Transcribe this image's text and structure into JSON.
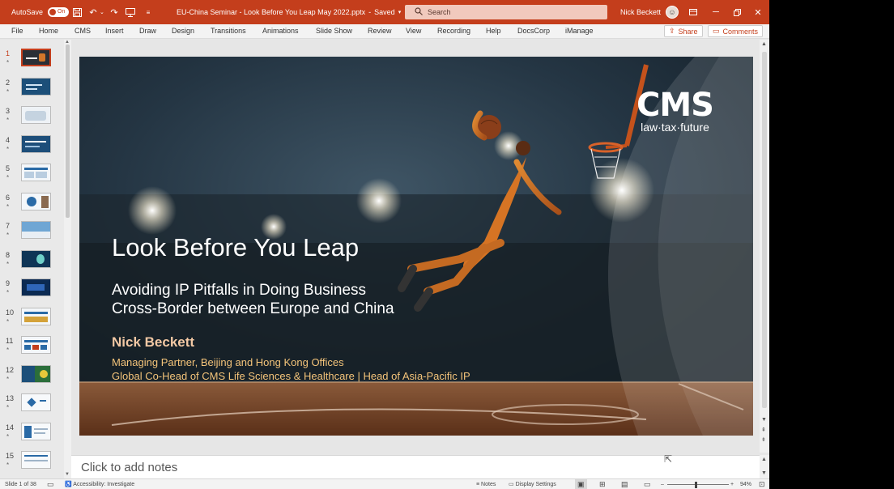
{
  "titlebar": {
    "autosave_label": "AutoSave",
    "autosave_state": "On",
    "document_title": "EU-China Seminar - Look Before You Leap May 2022.pptx",
    "saved_status": "Saved",
    "search_placeholder": "Search",
    "user_name": "Nick Beckett",
    "icons": [
      "save-icon",
      "undo-icon",
      "redo-icon",
      "present-icon",
      "customize-qat-icon"
    ]
  },
  "ribbon": {
    "tabs": [
      "File",
      "Home",
      "CMS",
      "Insert",
      "Draw",
      "Design",
      "Transitions",
      "Animations",
      "Slide Show",
      "Review",
      "View",
      "Recording",
      "Help",
      "DocsCorp",
      "iManage"
    ],
    "share_label": "Share",
    "comments_label": "Comments"
  },
  "thumbnails": {
    "numbers": [
      "1",
      "2",
      "3",
      "4",
      "5",
      "6",
      "7",
      "8",
      "9",
      "10",
      "11",
      "12",
      "13",
      "14",
      "15"
    ],
    "active_index": 0,
    "star": "*"
  },
  "slide": {
    "title": "Look Before You Leap",
    "subtitle_line1": "Avoiding IP Pitfalls in Doing Business",
    "subtitle_line2": "Cross-Border between Europe and China",
    "presenter_name": "Nick Beckett",
    "role_line1": "Managing Partner, Beijing and Hong Kong Offices",
    "role_line2": "Global Co-Head of CMS Life Sciences & Healthcare | Head of Asia-Pacific IP",
    "logo_text": "CMS",
    "logo_tagline": "law·tax·future"
  },
  "notes": {
    "placeholder": "Click to add notes"
  },
  "statusbar": {
    "slide_counter": "Slide 1 of 38",
    "accessibility": "Accessibility: Investigate",
    "notes_label": "Notes",
    "display_settings_label": "Display Settings",
    "zoom_minus": "–",
    "zoom_plus": "+",
    "zoom_level": "94%"
  },
  "colors": {
    "accent": "#c43e1c",
    "presenter_name": "#f2c8a4",
    "role_text": "#f4c47a"
  }
}
